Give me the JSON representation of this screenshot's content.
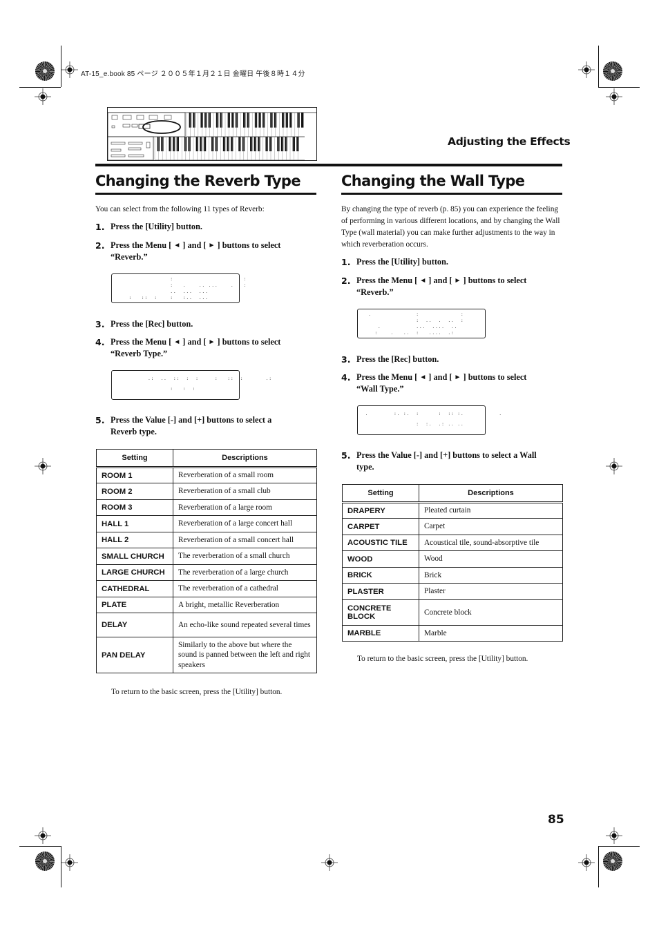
{
  "header_meta": "AT-15_e.book 85 ページ ２００５年１月２１日 金曜日 午後８時１４分",
  "section_header": "Adjusting the Effects",
  "page_number": "85",
  "reverb": {
    "title": "Changing the Reverb Type",
    "intro": "You can select from the following 11 types of Reverb:",
    "steps": [
      {
        "num": "1.",
        "text": "Press the [Utility] button."
      },
      {
        "num": "2.",
        "text_a": "Press the Menu [",
        "text_b": "] and [",
        "text_c": "] buttons to select",
        "text_d": "“Reverb.”"
      },
      {
        "num": "3.",
        "text": "Press the [Rec] button."
      },
      {
        "num": "4.",
        "text_a": "Press the Menu [",
        "text_b": "] and [",
        "text_c": "] buttons to select",
        "text_d": "“Reverb Type.”"
      },
      {
        "num": "5.",
        "text": "Press the Value [-] and [+] buttons to select a",
        "text2": "Reverb type."
      }
    ],
    "table": {
      "headers": [
        "Setting",
        "Descriptions"
      ],
      "rows": [
        {
          "setting": "ROOM 1",
          "description": "Reverberation of a small room"
        },
        {
          "setting": "ROOM 2",
          "description": "Reverberation of a small club"
        },
        {
          "setting": "ROOM 3",
          "description": "Reverberation of a large room"
        },
        {
          "setting": "HALL 1",
          "description": "Reverberation of a large concert hall"
        },
        {
          "setting": "HALL 2",
          "description": "Reverberation of a small concert hall"
        },
        {
          "setting": "SMALL CHURCH",
          "description": "The reverberation of a small church"
        },
        {
          "setting": "LARGE CHURCH",
          "description": "The reverberation of a large church"
        },
        {
          "setting": "CATHEDRAL",
          "description": "The reverberation of a cathedral"
        },
        {
          "setting": "PLATE",
          "description": "A bright, metallic Reverberation"
        },
        {
          "setting": "DELAY",
          "description": "An echo-like sound repeated several times"
        },
        {
          "setting": "PAN DELAY",
          "description": "Similarly to the above but where the sound is panned between the left and right speakers"
        }
      ]
    },
    "footer": "To return to the basic screen, press the [Utility] button."
  },
  "wall": {
    "title": "Changing the Wall Type",
    "intro": "By changing the type of reverb (p. 85) you can experience the feeling of performing in various different locations, and by changing the Wall Type (wall material) you can make further adjustments to the way in which reverberation occurs.",
    "steps": [
      {
        "num": "1.",
        "text": "Press the [Utility] button."
      },
      {
        "num": "2.",
        "text_a": "Press the Menu [",
        "text_b": "] and [",
        "text_c": "] buttons to select",
        "text_d": "“Reverb.”"
      },
      {
        "num": "3.",
        "text": "Press the [Rec] button."
      },
      {
        "num": "4.",
        "text_a": "Press the Menu [",
        "text_b": "] and [",
        "text_c": "] buttons to select",
        "text_d": "“Wall Type.”"
      },
      {
        "num": "5.",
        "text": "Press the Value [-] and [+] buttons to select a Wall",
        "text2": "type."
      }
    ],
    "table": {
      "headers": [
        "Setting",
        "Descriptions"
      ],
      "rows": [
        {
          "setting": "DRAPERY",
          "description": "Pleated curtain"
        },
        {
          "setting": "CARPET",
          "description": "Carpet"
        },
        {
          "setting": "ACOUSTIC TILE",
          "description": "Acoustical tile, sound-absorptive tile"
        },
        {
          "setting": "WOOD",
          "description": "Wood"
        },
        {
          "setting": "BRICK",
          "description": "Brick"
        },
        {
          "setting": "PLASTER",
          "description": "Plaster"
        },
        {
          "setting": "CONCRETE BLOCK",
          "description": "Concrete block"
        },
        {
          "setting": "MARBLE",
          "description": "Marble"
        }
      ]
    },
    "footer": "To return to the basic screen, press the [Utility] button."
  },
  "icons": {
    "left_arrow": "◄",
    "right_arrow": "►"
  },
  "lcd": {
    "reverb_1": "                 :                      :\n                 :   .    .. ...    .   :\n                 ..  ...  ...\n    :   ::  :    :   :..  ...",
    "reverb_2": "          .:  ..  ::  :  :     :   ::  :       .:\n                 :   :  :",
    "wall_1": "  .              :             :\n                 :  ..  .  ..  :\n     .           ...  ....  ..\n    :    .   ..  :   ....  .:",
    "wall_2": " .        :. :.  :      :  :: :.           .\n                 :  :.  .: .. .."
  }
}
